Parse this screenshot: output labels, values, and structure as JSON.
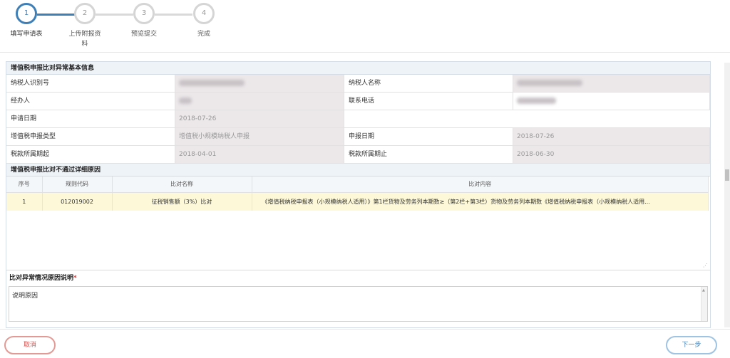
{
  "steps": [
    {
      "num": "1",
      "label": "填写申请表",
      "active": true
    },
    {
      "num": "2",
      "label": "上传附报资\n料",
      "active": false
    },
    {
      "num": "3",
      "label": "预览提交",
      "active": false
    },
    {
      "num": "4",
      "label": "完成",
      "active": false
    }
  ],
  "basic_info": {
    "title": "增值税申报比对异常基本信息",
    "taxpayer_id_label": "纳税人识别号",
    "taxpayer_name_label": "纳税人名称",
    "agent_label": "经办人",
    "phone_label": "联系电话",
    "apply_date_label": "申请日期",
    "apply_date": "2018-07-26",
    "vat_type_label": "增值税申报类型",
    "vat_type": "增值税小规模纳税人申报",
    "declare_date_label": "申报日期",
    "declare_date": "2018-07-26",
    "period_start_label": "税款所属期起",
    "period_start": "2018-04-01",
    "period_end_label": "税款所属期止",
    "period_end": "2018-06-30"
  },
  "detail": {
    "title": "增值税申报比对不通过详细原因",
    "columns": [
      "序号",
      "规则代码",
      "比对名称",
      "比对内容"
    ],
    "rows": [
      {
        "index": "1",
        "code": "012019002",
        "name": "征税销售额（3%）比对",
        "content": "《增值税纳税申报表（小规模纳税人适用）》第1栏货物及劳务列本期数≥（第2栏+第3栏）货物及劳务列本期数《增值税纳税申报表（小规模纳税人适用..."
      }
    ]
  },
  "reason": {
    "title": "比对异常情况原因说明",
    "required_mark": "*",
    "value": "说明原因"
  },
  "buttons": {
    "cancel": "取消",
    "next": "下一步"
  },
  "colors": {
    "accent": "#3f7fb8",
    "cancel": "#d9534f",
    "row_highlight": "#fdf9d8",
    "readonly_bg": "#ece8ea"
  }
}
